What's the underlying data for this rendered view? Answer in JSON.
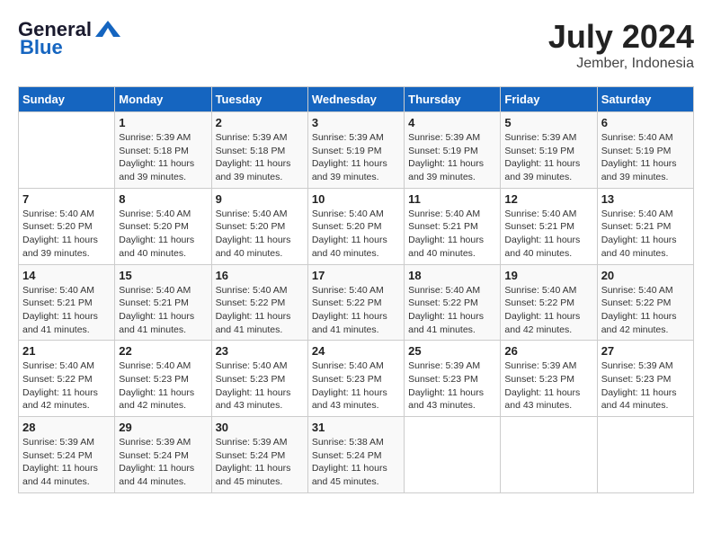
{
  "logo": {
    "general": "General",
    "blue": "Blue"
  },
  "header": {
    "month_year": "July 2024",
    "location": "Jember, Indonesia"
  },
  "weekdays": [
    "Sunday",
    "Monday",
    "Tuesday",
    "Wednesday",
    "Thursday",
    "Friday",
    "Saturday"
  ],
  "weeks": [
    [
      {
        "day": "",
        "info": ""
      },
      {
        "day": "1",
        "info": "Sunrise: 5:39 AM\nSunset: 5:18 PM\nDaylight: 11 hours and 39 minutes."
      },
      {
        "day": "2",
        "info": "Sunrise: 5:39 AM\nSunset: 5:18 PM\nDaylight: 11 hours and 39 minutes."
      },
      {
        "day": "3",
        "info": "Sunrise: 5:39 AM\nSunset: 5:19 PM\nDaylight: 11 hours and 39 minutes."
      },
      {
        "day": "4",
        "info": "Sunrise: 5:39 AM\nSunset: 5:19 PM\nDaylight: 11 hours and 39 minutes."
      },
      {
        "day": "5",
        "info": "Sunrise: 5:39 AM\nSunset: 5:19 PM\nDaylight: 11 hours and 39 minutes."
      },
      {
        "day": "6",
        "info": "Sunrise: 5:40 AM\nSunset: 5:19 PM\nDaylight: 11 hours and 39 minutes."
      }
    ],
    [
      {
        "day": "7",
        "info": "Sunrise: 5:40 AM\nSunset: 5:20 PM\nDaylight: 11 hours and 39 minutes."
      },
      {
        "day": "8",
        "info": "Sunrise: 5:40 AM\nSunset: 5:20 PM\nDaylight: 11 hours and 40 minutes."
      },
      {
        "day": "9",
        "info": "Sunrise: 5:40 AM\nSunset: 5:20 PM\nDaylight: 11 hours and 40 minutes."
      },
      {
        "day": "10",
        "info": "Sunrise: 5:40 AM\nSunset: 5:20 PM\nDaylight: 11 hours and 40 minutes."
      },
      {
        "day": "11",
        "info": "Sunrise: 5:40 AM\nSunset: 5:21 PM\nDaylight: 11 hours and 40 minutes."
      },
      {
        "day": "12",
        "info": "Sunrise: 5:40 AM\nSunset: 5:21 PM\nDaylight: 11 hours and 40 minutes."
      },
      {
        "day": "13",
        "info": "Sunrise: 5:40 AM\nSunset: 5:21 PM\nDaylight: 11 hours and 40 minutes."
      }
    ],
    [
      {
        "day": "14",
        "info": "Sunrise: 5:40 AM\nSunset: 5:21 PM\nDaylight: 11 hours and 41 minutes."
      },
      {
        "day": "15",
        "info": "Sunrise: 5:40 AM\nSunset: 5:21 PM\nDaylight: 11 hours and 41 minutes."
      },
      {
        "day": "16",
        "info": "Sunrise: 5:40 AM\nSunset: 5:22 PM\nDaylight: 11 hours and 41 minutes."
      },
      {
        "day": "17",
        "info": "Sunrise: 5:40 AM\nSunset: 5:22 PM\nDaylight: 11 hours and 41 minutes."
      },
      {
        "day": "18",
        "info": "Sunrise: 5:40 AM\nSunset: 5:22 PM\nDaylight: 11 hours and 41 minutes."
      },
      {
        "day": "19",
        "info": "Sunrise: 5:40 AM\nSunset: 5:22 PM\nDaylight: 11 hours and 42 minutes."
      },
      {
        "day": "20",
        "info": "Sunrise: 5:40 AM\nSunset: 5:22 PM\nDaylight: 11 hours and 42 minutes."
      }
    ],
    [
      {
        "day": "21",
        "info": "Sunrise: 5:40 AM\nSunset: 5:22 PM\nDaylight: 11 hours and 42 minutes."
      },
      {
        "day": "22",
        "info": "Sunrise: 5:40 AM\nSunset: 5:23 PM\nDaylight: 11 hours and 42 minutes."
      },
      {
        "day": "23",
        "info": "Sunrise: 5:40 AM\nSunset: 5:23 PM\nDaylight: 11 hours and 43 minutes."
      },
      {
        "day": "24",
        "info": "Sunrise: 5:40 AM\nSunset: 5:23 PM\nDaylight: 11 hours and 43 minutes."
      },
      {
        "day": "25",
        "info": "Sunrise: 5:39 AM\nSunset: 5:23 PM\nDaylight: 11 hours and 43 minutes."
      },
      {
        "day": "26",
        "info": "Sunrise: 5:39 AM\nSunset: 5:23 PM\nDaylight: 11 hours and 43 minutes."
      },
      {
        "day": "27",
        "info": "Sunrise: 5:39 AM\nSunset: 5:23 PM\nDaylight: 11 hours and 44 minutes."
      }
    ],
    [
      {
        "day": "28",
        "info": "Sunrise: 5:39 AM\nSunset: 5:24 PM\nDaylight: 11 hours and 44 minutes."
      },
      {
        "day": "29",
        "info": "Sunrise: 5:39 AM\nSunset: 5:24 PM\nDaylight: 11 hours and 44 minutes."
      },
      {
        "day": "30",
        "info": "Sunrise: 5:39 AM\nSunset: 5:24 PM\nDaylight: 11 hours and 45 minutes."
      },
      {
        "day": "31",
        "info": "Sunrise: 5:38 AM\nSunset: 5:24 PM\nDaylight: 11 hours and 45 minutes."
      },
      {
        "day": "",
        "info": ""
      },
      {
        "day": "",
        "info": ""
      },
      {
        "day": "",
        "info": ""
      }
    ]
  ]
}
